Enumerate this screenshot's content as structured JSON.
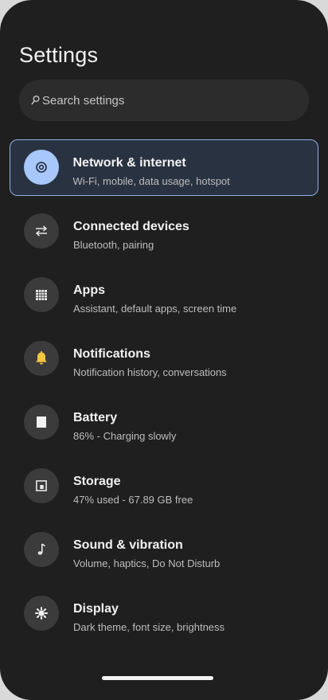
{
  "header": {
    "title": "Settings"
  },
  "search": {
    "placeholder": "Search settings"
  },
  "colors": {
    "background": "#1f1f1f",
    "accent": "#a8c7fa",
    "selected_bg": "#293241",
    "selected_border": "#8fb0e3"
  },
  "settings_items": [
    {
      "title": "Network & internet",
      "subtitle": "Wi-Fi, mobile, data usage, hotspot",
      "icon": "wifi-target-icon",
      "selected": true
    },
    {
      "title": "Connected devices",
      "subtitle": "Bluetooth, pairing",
      "icon": "swap-arrows-icon",
      "selected": false
    },
    {
      "title": "Apps",
      "subtitle": "Assistant, default apps, screen time",
      "icon": "apps-grid-icon",
      "selected": false
    },
    {
      "title": "Notifications",
      "subtitle": "Notification history, conversations",
      "icon": "bell-icon",
      "selected": false
    },
    {
      "title": "Battery",
      "subtitle": "86% - Charging slowly",
      "icon": "battery-icon",
      "selected": false
    },
    {
      "title": "Storage",
      "subtitle": "47% used - 67.89 GB free",
      "icon": "storage-icon",
      "selected": false
    },
    {
      "title": "Sound & vibration",
      "subtitle": "Volume, haptics, Do Not Disturb",
      "icon": "music-note-icon",
      "selected": false
    },
    {
      "title": "Display",
      "subtitle": "Dark theme, font size, brightness",
      "icon": "brightness-icon",
      "selected": false
    }
  ]
}
